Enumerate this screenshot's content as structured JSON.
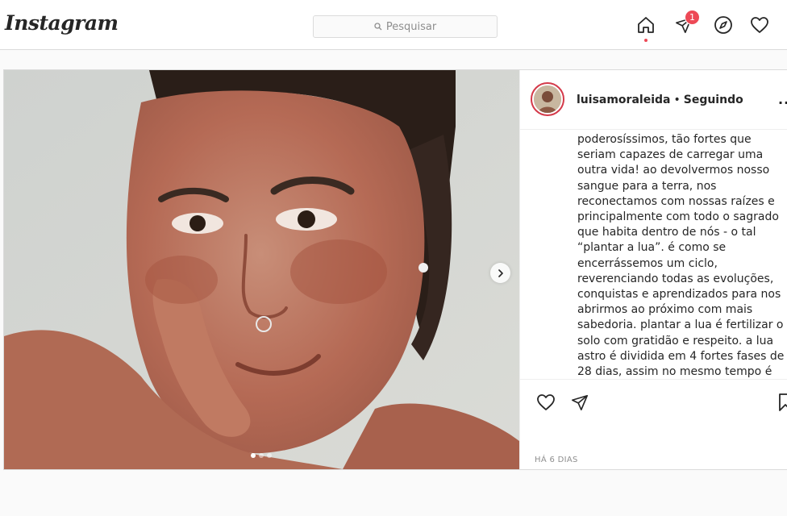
{
  "header": {
    "logo_text": "Instagram",
    "search_placeholder": "Pesquisar",
    "direct_badge_count": "1",
    "icons": [
      "home-icon",
      "direct-icon",
      "explore-icon",
      "heart-icon"
    ],
    "accent_color": "#ed4956"
  },
  "post": {
    "username": "luisamoraleida",
    "separator": "•",
    "follow_status": "Seguindo",
    "more_label": "...",
    "caption": "poderosíssimos, tão fortes que seriam capazes de carregar uma outra vida! ao devolvermos nosso sangue para a terra, nos reconectamos com nossas raízes e principalmente com todo o sagrado que habita dentro de nós - o tal “plantar a lua”. é como se encerrássemos um ciclo, reverenciando todas as evoluções, conquistas e aprendizados para nos abrirmos ao próximo com mais sabedoria. plantar a lua é fertilizar o solo com gratidão e respeito. a lua astro é dividida em 4 fortes fases de 28 dias, assim no mesmo tempo é também com nossa lua interna (A",
    "timestamp": "HÁ 6 DIAS",
    "carousel": {
      "total_slides": 3,
      "active_slide": 1
    },
    "image_description_icon": "photo-face-closeup"
  }
}
